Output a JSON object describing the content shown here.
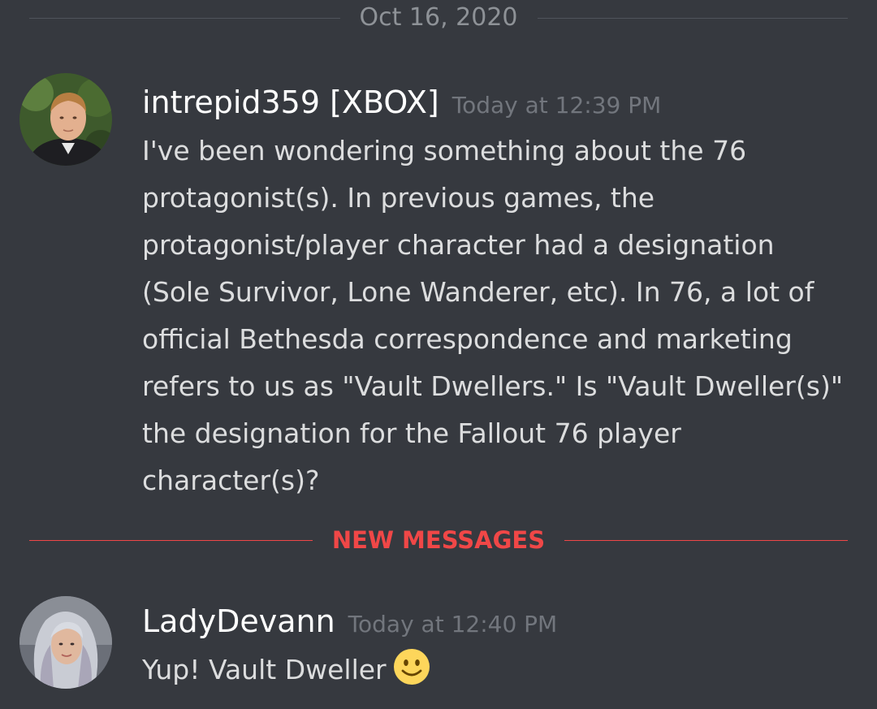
{
  "date_divider": {
    "label": "Oct 16, 2020"
  },
  "new_messages_divider": {
    "label": "NEW MESSAGES"
  },
  "messages": [
    {
      "username": "intrepid359 [XBOX]",
      "timestamp": "Today at 12:39 PM",
      "content": "I've been wondering something about the 76 protagonist(s). In previous games, the protagonist/player character had a designation (Sole Survivor, Lone Wanderer, etc). In 76, a lot of official Bethesda correspondence and marketing refers to us as \"Vault Dwellers.\" Is \"Vault Dweller(s)\" the designation for the Fallout 76 player character(s)?"
    },
    {
      "username": "LadyDevann",
      "timestamp": "Today at 12:40 PM",
      "content": "Yup! Vault Dweller",
      "emoji": "slightly-smiling-face-icon"
    }
  ],
  "colors": {
    "background": "#36393f",
    "username": "#ffffff",
    "timestamp": "#72767d",
    "message_text": "#dcddde",
    "new_messages": "#f04747",
    "date_divider_line": "#4f545c"
  }
}
